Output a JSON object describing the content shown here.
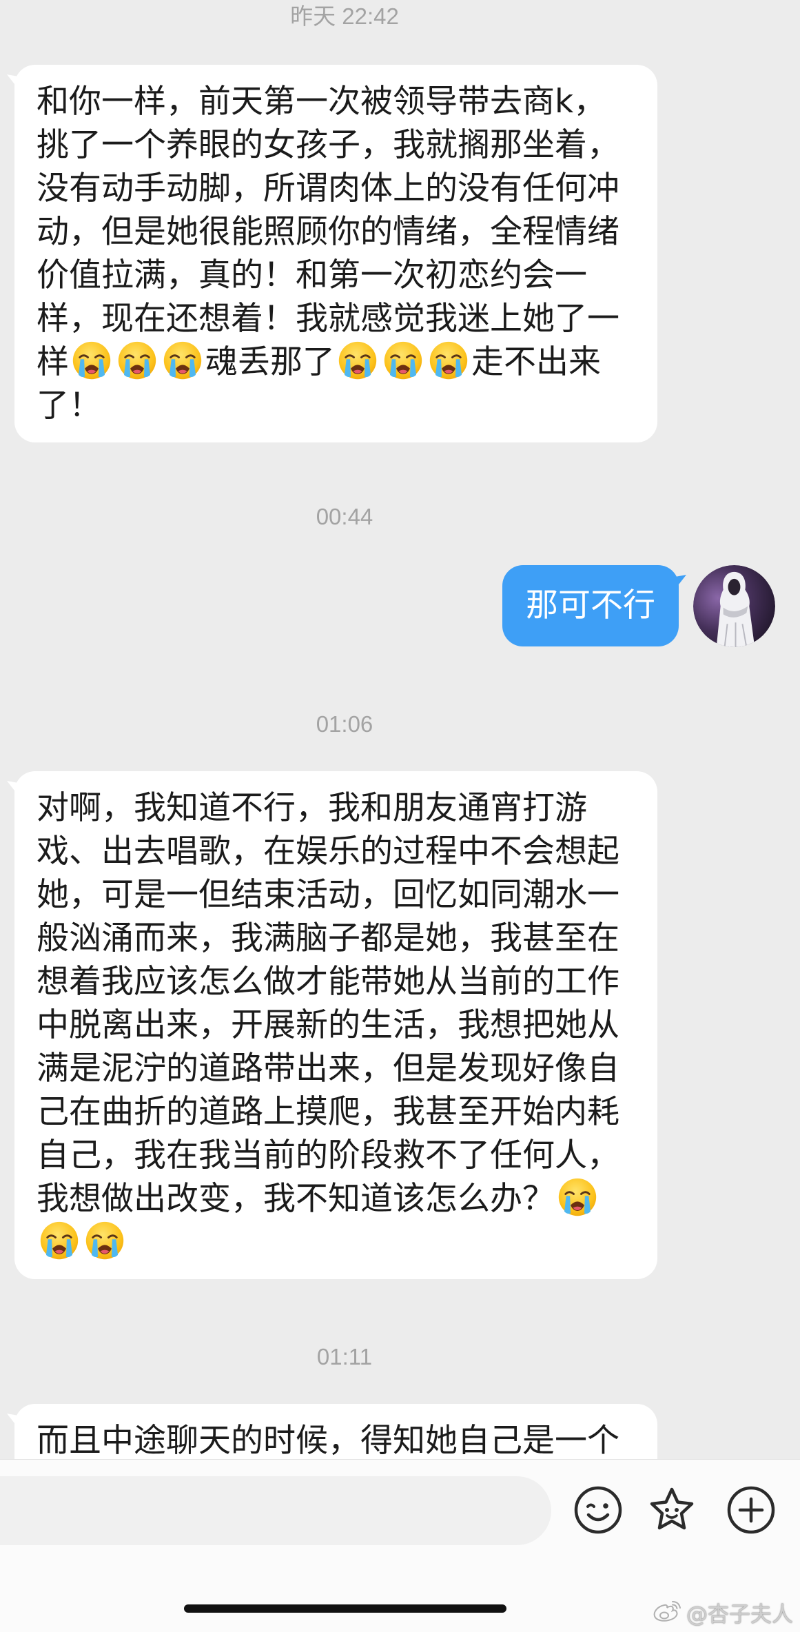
{
  "colors": {
    "chat_background": "#ececec",
    "incoming_bubble": "#ffffff",
    "outgoing_bubble": "#3e9ff6",
    "timestamp_text": "#a3a3a3"
  },
  "chat": {
    "timestamps": [
      "昨天 22:42",
      "00:44",
      "01:06",
      "01:11"
    ],
    "messages": [
      {
        "sender": "other",
        "segments": [
          {
            "text": "和你一样，前天第一次被领导带去商k，挑了一个养眼的女孩子，我就搁那坐着，没有动手动脚，所谓肉体上的没有任何冲动，但是她很能照顾你的情绪，全程情绪价值拉满，真的！和第一次初恋约会一样，现在还想着！我就感觉我迷上她了一样"
          },
          {
            "emoji": "loudly-crying-face"
          },
          {
            "emoji": "loudly-crying-face"
          },
          {
            "emoji": "loudly-crying-face"
          },
          {
            "text": "魂丢那了"
          },
          {
            "emoji": "loudly-crying-face"
          },
          {
            "emoji": "loudly-crying-face"
          },
          {
            "emoji": "loudly-crying-face"
          },
          {
            "text": "走不出来了！"
          }
        ]
      },
      {
        "sender": "me",
        "avatar": "hooded-figure-avatar",
        "segments": [
          {
            "text": "那可不行"
          }
        ]
      },
      {
        "sender": "other",
        "segments": [
          {
            "text": "对啊，我知道不行，我和朋友通宵打游戏、出去唱歌，在娱乐的过程中不会想起她，可是一但结束活动，回忆如同潮水一般汹涌而来，我满脑子都是她，我甚至在想着我应该怎么做才能带她从当前的工作中脱离出来，开展新的生活，我想把她从满是泥泞的道路带出来，但是发现好像自己在曲折的道路上摸爬，我甚至开始内耗自己，我在我当前的阶段救不了任何人，我想做出改变，我不知道该怎么办？"
          },
          {
            "emoji": "loudly-crying-face"
          },
          {
            "emoji": "loudly-crying-face"
          },
          {
            "emoji": "loudly-crying-face"
          }
        ]
      },
      {
        "sender": "other",
        "segments": [
          {
            "text": "而且中途聊天的时候，得知她自己是一个"
          }
        ]
      }
    ]
  },
  "input_bar": {
    "icons": [
      "smiley-face-icon",
      "sticker-icon",
      "plus-icon"
    ]
  },
  "watermark": {
    "icon": "weibo-logo-icon",
    "text": "@杏子夫人"
  }
}
